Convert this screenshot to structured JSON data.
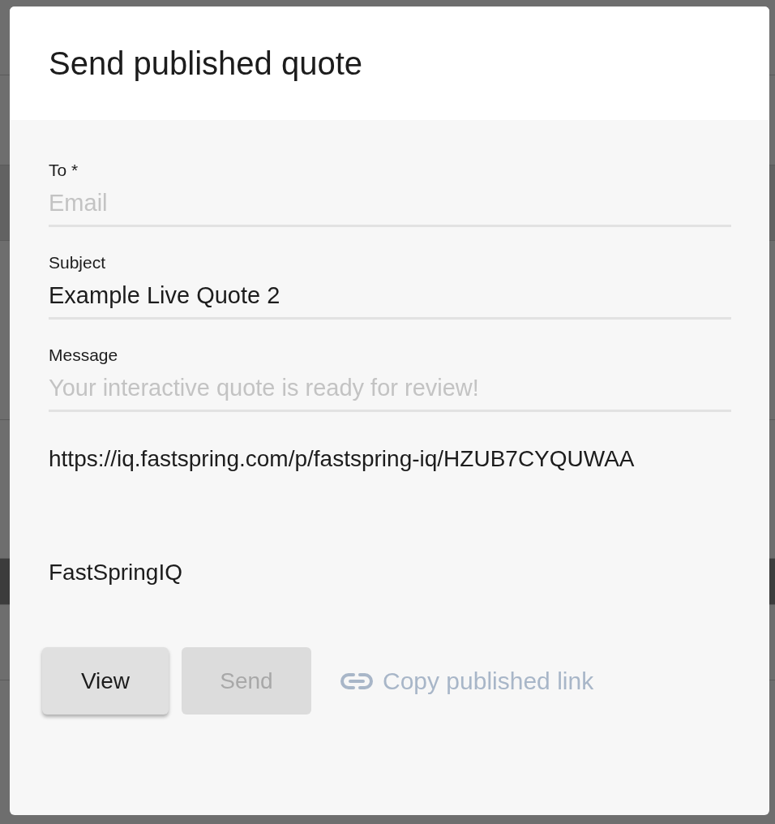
{
  "dialog": {
    "title": "Send published quote"
  },
  "fields": [
    {
      "label": "To *",
      "placeholder": "Email"
    },
    {
      "label": "Subject",
      "value": "Example Live Quote 2"
    },
    {
      "label": "Message",
      "placeholder": "Your interactive quote is ready for review!"
    }
  ],
  "link_text": "https://iq.fastspring.com/p/fastspring-iq/HZUB7CYQUWAA",
  "signature": "FastSpringIQ",
  "buttons": [
    {
      "label": "View",
      "disabled": false
    },
    {
      "label": "Send",
      "disabled": true
    }
  ],
  "copy_link": {
    "label": "Copy published link"
  }
}
